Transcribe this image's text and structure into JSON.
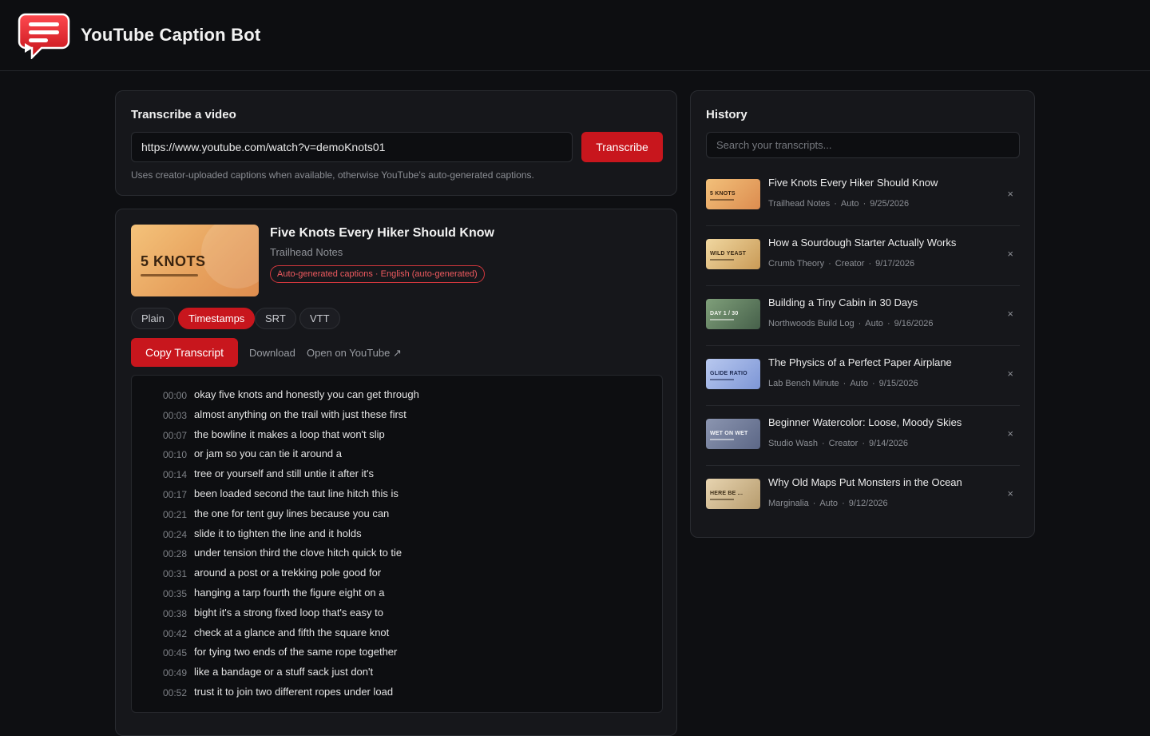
{
  "header": {
    "title": "YouTube Caption Bot"
  },
  "transcribe": {
    "title": "Transcribe a video",
    "url_value": "https://www.youtube.com/watch?v=demoKnots01",
    "button_label": "Transcribe",
    "hint": "Uses creator-uploaded captions when available, otherwise YouTube's auto-generated captions."
  },
  "result": {
    "thumb_text": "5 KNOTS",
    "title": "Five Knots Every Hiker Should Know",
    "channel": "Trailhead Notes",
    "badge": "Auto-generated captions · English (auto-generated)",
    "formats": [
      "Plain",
      "Timestamps",
      "SRT",
      "VTT"
    ],
    "active_format": "Timestamps",
    "copy_label": "Copy Transcript",
    "download_label": "Download",
    "open_label": "Open on YouTube ↗",
    "lines": [
      {
        "t": "00:00",
        "text": "okay five knots and honestly you can get through"
      },
      {
        "t": "00:03",
        "text": "almost anything on the trail with just these first"
      },
      {
        "t": "00:07",
        "text": "the bowline it makes a loop that won't slip"
      },
      {
        "t": "00:10",
        "text": "or jam so you can tie it around a"
      },
      {
        "t": "00:14",
        "text": "tree or yourself and still untie it after it's"
      },
      {
        "t": "00:17",
        "text": "been loaded second the taut line hitch this is"
      },
      {
        "t": "00:21",
        "text": "the one for tent guy lines because you can"
      },
      {
        "t": "00:24",
        "text": "slide it to tighten the line and it holds"
      },
      {
        "t": "00:28",
        "text": "under tension third the clove hitch quick to tie"
      },
      {
        "t": "00:31",
        "text": "around a post or a trekking pole good for"
      },
      {
        "t": "00:35",
        "text": "hanging a tarp fourth the figure eight on a"
      },
      {
        "t": "00:38",
        "text": "bight it's a strong fixed loop that's easy to"
      },
      {
        "t": "00:42",
        "text": "check at a glance and fifth the square knot"
      },
      {
        "t": "00:45",
        "text": "for tying two ends of the same rope together"
      },
      {
        "t": "00:49",
        "text": "like a bandage or a stuff sack just don't"
      },
      {
        "t": "00:52",
        "text": "trust it to join two different ropes under load"
      }
    ]
  },
  "history": {
    "title": "History",
    "search_placeholder": "Search your transcripts...",
    "items": [
      {
        "thumb": "5 KNOTS",
        "colors": [
          "#f2c07a",
          "#dc8c4f"
        ],
        "ink": "#3a2410",
        "title": "Five Knots Every Hiker Should Know",
        "meta": [
          "Trailhead Notes",
          "Auto",
          "9/25/2026"
        ]
      },
      {
        "thumb": "WILD YEAST",
        "colors": [
          "#f0d7a0",
          "#c99a56"
        ],
        "ink": "#3b2a14",
        "title": "How a Sourdough Starter Actually Works",
        "meta": [
          "Crumb Theory",
          "Creator",
          "9/17/2026"
        ]
      },
      {
        "thumb": "DAY 1 / 30",
        "colors": [
          "#7f9f7a",
          "#46604a"
        ],
        "ink": "#f2f4ee",
        "title": "Building a Tiny Cabin in 30 Days",
        "meta": [
          "Northwoods Build Log",
          "Auto",
          "9/16/2026"
        ]
      },
      {
        "thumb": "GLIDE RATIO",
        "colors": [
          "#b8c8ef",
          "#7d96d6"
        ],
        "ink": "#1d2a52",
        "title": "The Physics of a Perfect Paper Airplane",
        "meta": [
          "Lab Bench Minute",
          "Auto",
          "9/15/2026"
        ]
      },
      {
        "thumb": "WET ON WET",
        "colors": [
          "#8b95b0",
          "#5c6786"
        ],
        "ink": "#f4f5f8",
        "title": "Beginner Watercolor: Loose, Moody Skies",
        "meta": [
          "Studio Wash",
          "Creator",
          "9/14/2026"
        ]
      },
      {
        "thumb": "HERE BE ...",
        "colors": [
          "#e7d4b0",
          "#b79c6e"
        ],
        "ink": "#3b2c16",
        "title": "Why Old Maps Put Monsters in the Ocean",
        "meta": [
          "Marginalia",
          "Auto",
          "9/12/2026"
        ]
      }
    ]
  }
}
